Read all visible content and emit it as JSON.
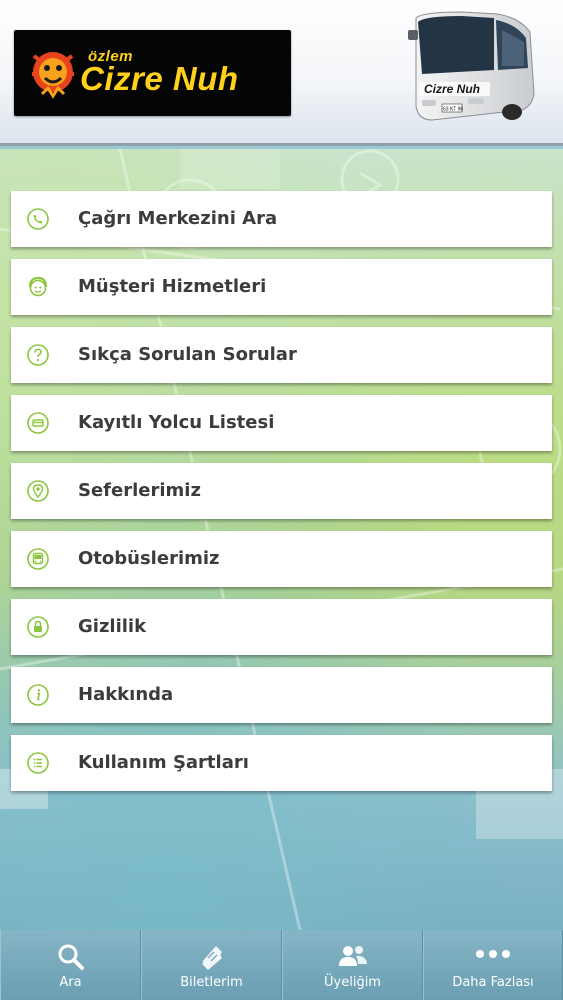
{
  "header": {
    "logo_small": "özlem",
    "logo_big": "Cizre Nuh",
    "bus_label": "Cizre Nuh",
    "bus_plate": "63 KT 96"
  },
  "menu": {
    "items": [
      {
        "label": "Çağrı Merkezini Ara",
        "icon": "phone-icon"
      },
      {
        "label": "Müşteri Hizmetleri",
        "icon": "customer-service-icon"
      },
      {
        "label": "Sıkça Sorulan Sorular",
        "icon": "question-icon"
      },
      {
        "label": "Kayıtlı Yolcu Listesi",
        "icon": "card-icon"
      },
      {
        "label": "Seferlerimiz",
        "icon": "location-pin-icon"
      },
      {
        "label": "Otobüslerimiz",
        "icon": "bus-icon"
      },
      {
        "label": "Gizlilik",
        "icon": "lock-icon"
      },
      {
        "label": "Hakkında",
        "icon": "info-icon"
      },
      {
        "label": "Kullanım Şartları",
        "icon": "list-icon"
      }
    ]
  },
  "nav": {
    "items": [
      {
        "label": "Ara",
        "icon": "search-icon"
      },
      {
        "label": "Biletlerim",
        "icon": "ticket-icon"
      },
      {
        "label": "Üyeliğim",
        "icon": "users-icon"
      },
      {
        "label": "Daha Fazlası",
        "icon": "more-icon"
      }
    ]
  },
  "colors": {
    "accent_green": "#8cc63f",
    "menu_text": "#3c3c3c",
    "logo_yellow": "#ffd11a",
    "nav_bg": "#6fa3b7"
  }
}
